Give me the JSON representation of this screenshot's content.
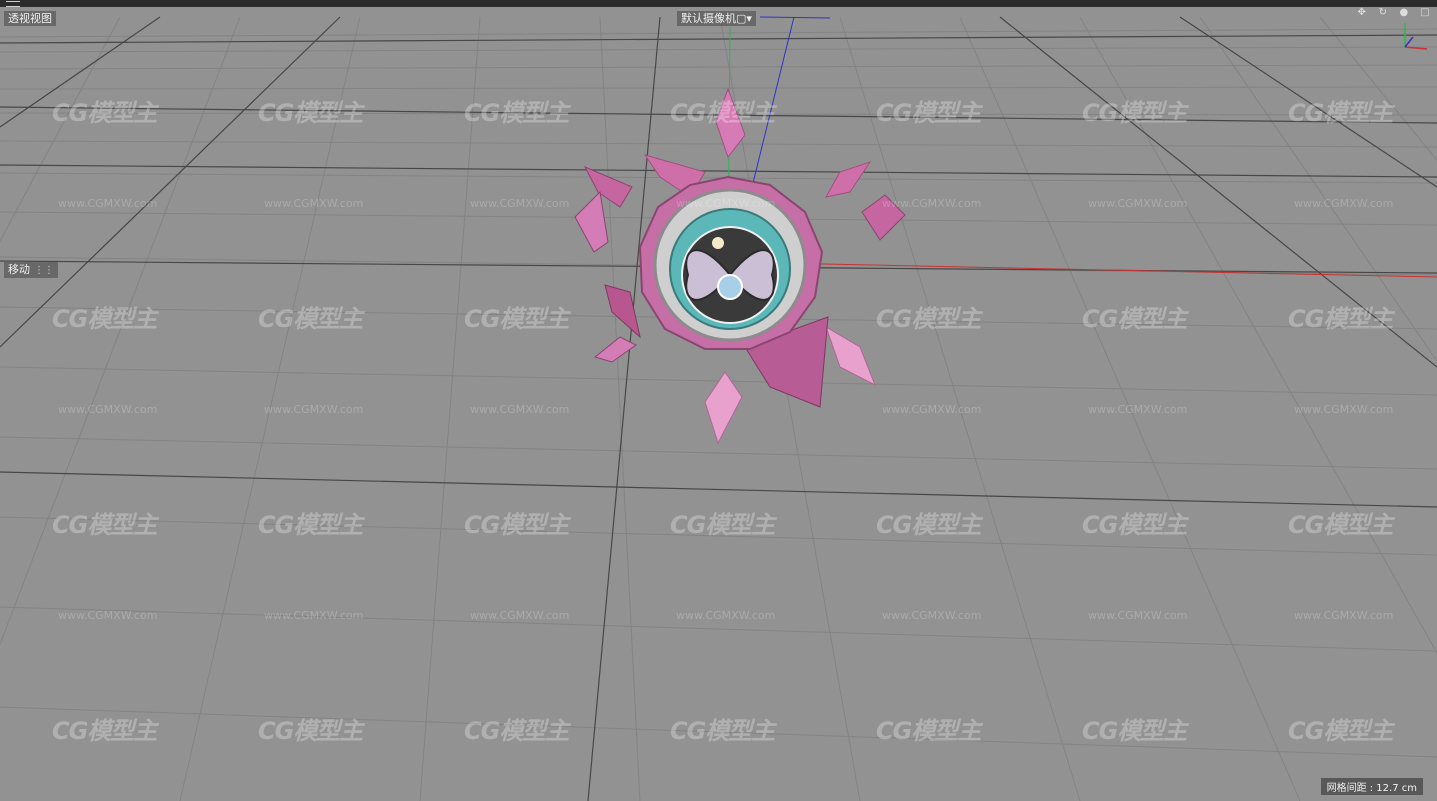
{
  "app": {
    "viewport_title": "透视视图",
    "camera_label": "默认摄像机",
    "camera_icon": "camera-icon",
    "active_tool": "移动",
    "grid_spacing": "网格间距 : 12.7 cm"
  },
  "nav_icons": [
    "move-view-icon",
    "rotate-view-icon",
    "zoom-view-icon",
    "maximize-view-icon"
  ],
  "watermark": {
    "logo_text": "CG模型主",
    "url_text": "www.CGMXW.com"
  },
  "colors": {
    "viewport_bg": "#929292",
    "grid_line": "#7d7d7d",
    "grid_major": "#3e3e3e",
    "x_axis": "#c83232",
    "y_axis": "#32b450",
    "z_axis": "#3232c8",
    "model_pink": "#d77bb6"
  }
}
